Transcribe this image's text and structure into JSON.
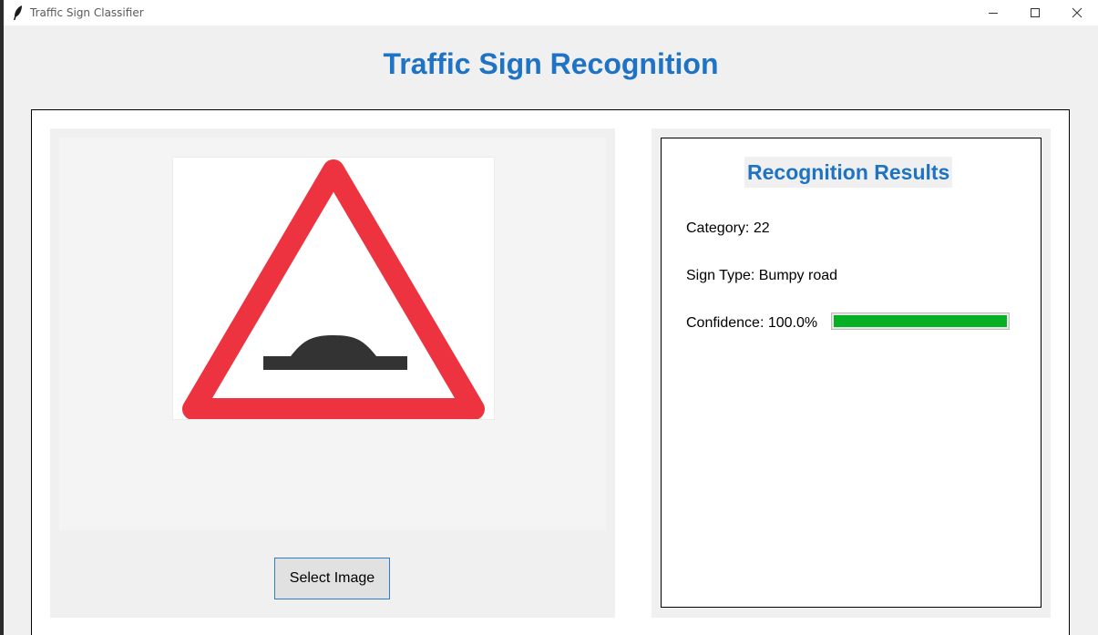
{
  "window": {
    "title": "Traffic Sign Classifier"
  },
  "header": {
    "title": "Traffic Sign Recognition"
  },
  "left_panel": {
    "image_icon": "bumpy-road-warning-sign",
    "select_button_label": "Select Image"
  },
  "results": {
    "title": "Recognition Results",
    "category_text": "Category: 22",
    "sign_type_text": "Sign Type: Bumpy road",
    "confidence_text": "Confidence: 100.0%",
    "confidence_value": 100.0
  },
  "colors": {
    "accent": "#1f73c4",
    "progress": "#06b025",
    "sign_red": "#ee3340",
    "sign_bump": "#333333"
  }
}
